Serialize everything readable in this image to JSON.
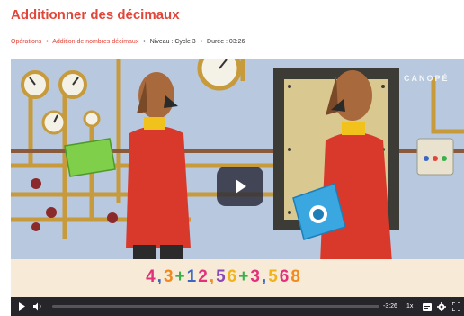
{
  "page": {
    "title": "Additionner des décimaux"
  },
  "meta": {
    "breadcrumb": [
      {
        "label": "Opérations"
      },
      {
        "label": "Addition de nombres décimaux"
      }
    ],
    "level": "Niveau : Cycle 3",
    "duration": "Durée : 03:26"
  },
  "video": {
    "watermark": "CANOPÉ",
    "formula_parts": [
      {
        "text": "4",
        "color": "#e2317a"
      },
      {
        "text": ",",
        "color": "#3c66c4"
      },
      {
        "text": "3",
        "color": "#f08a1c"
      },
      {
        "text": "+",
        "color": "#3ab04a"
      },
      {
        "text": "1",
        "color": "#3c66c4"
      },
      {
        "text": "2",
        "color": "#e2317a"
      },
      {
        "text": ",",
        "color": "#f08a1c"
      },
      {
        "text": "5",
        "color": "#8a47b8"
      },
      {
        "text": "6",
        "color": "#f0b31c"
      },
      {
        "text": "+",
        "color": "#3ab04a"
      },
      {
        "text": "3",
        "color": "#e2317a"
      },
      {
        "text": ",",
        "color": "#3c66c4"
      },
      {
        "text": "5",
        "color": "#f0b31c"
      },
      {
        "text": "6",
        "color": "#e2317a"
      },
      {
        "text": "8",
        "color": "#f08a1c"
      }
    ],
    "progress": 0.0,
    "time_remaining": "-3:26",
    "playback_rate": "1x",
    "accent_color": "#e2453a",
    "icons": [
      "play-icon",
      "volume-icon",
      "subtitles-icon",
      "settings-icon",
      "fullscreen-icon"
    ]
  }
}
